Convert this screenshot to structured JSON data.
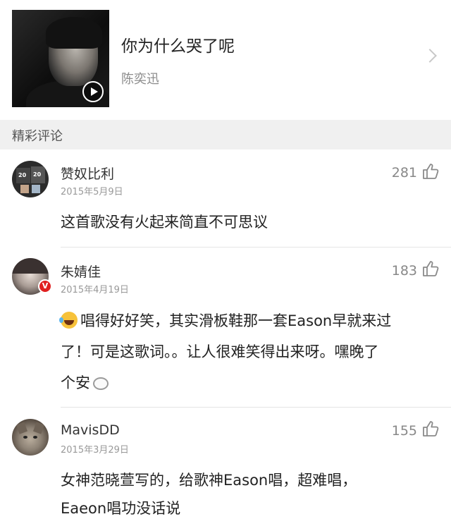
{
  "song": {
    "title": "你为什么哭了呢",
    "artist": "陈奕迅"
  },
  "section": {
    "label": "精彩评论"
  },
  "comments": [
    {
      "user": "赞奴比利",
      "date": "2015年5月9日",
      "likes": "281",
      "text": "这首歌没有火起来简直不可思议"
    },
    {
      "user": "朱婧佳",
      "date": "2015年4月19日",
      "likes": "183",
      "verified_badge": "V",
      "text_line1": "唱得好好笑，其实滑板鞋那一套Eason早就来过",
      "text_line2": "了！可是这歌词。。让人很难笑得出来呀。嘿晚了",
      "text_line3": "个安"
    },
    {
      "user": "MavisDD",
      "date": "2015年3月29日",
      "likes": "155",
      "text_line1": "女神范晓萱写的，给歌神Eason唱，超难唱，",
      "text_line2": "Eaeon唱功没话说"
    }
  ],
  "icons": {
    "like": "thumbs-up-icon",
    "play": "play-icon",
    "chevron": "chevron-right-icon",
    "emoji_laugh": "tears-of-joy-emoji",
    "emoji_bubble": "thought-bubble-emoji"
  },
  "colors": {
    "verified_badge": "#e02020",
    "section_bg": "#f0f0f0"
  }
}
